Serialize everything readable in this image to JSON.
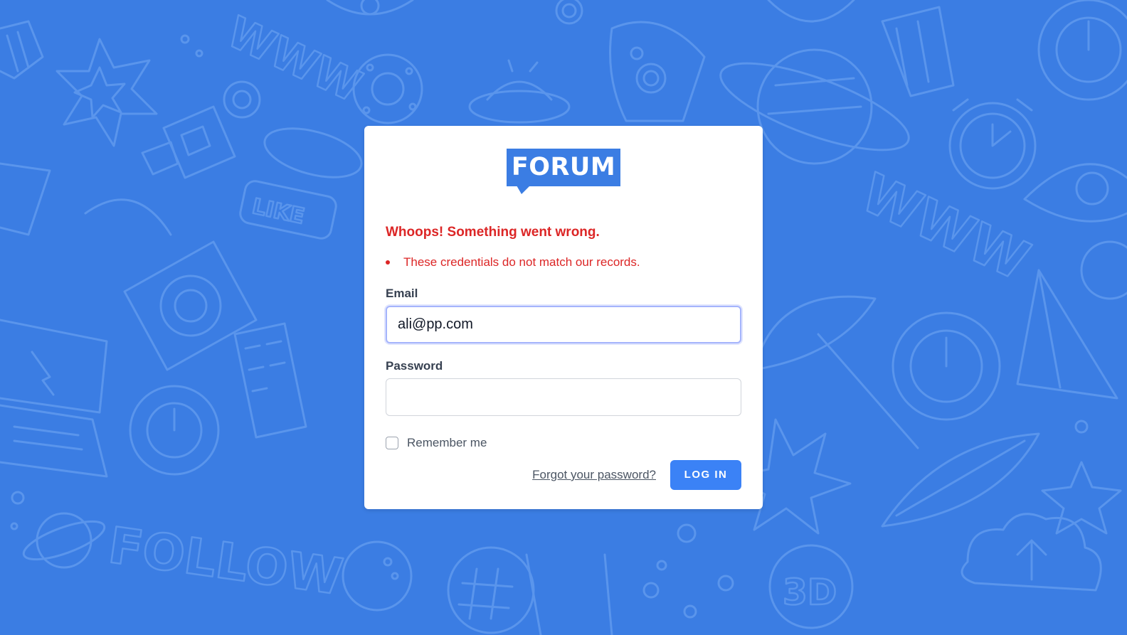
{
  "brand": {
    "logo_text": "FORUM"
  },
  "errors": {
    "title": "Whoops! Something went wrong.",
    "items": [
      "These credentials do not match our records."
    ]
  },
  "form": {
    "email_label": "Email",
    "email_value": "ali@pp.com",
    "password_label": "Password",
    "password_value": "",
    "remember_label": "Remember me",
    "remember_checked": false,
    "forgot_link": "Forgot your password?",
    "login_button": "LOG IN"
  },
  "background_doodles": {
    "like_text": "LIKE",
    "follow_text": "FOLLOW",
    "www_text": "WWW",
    "threed_text": "3D"
  },
  "colors": {
    "background": "#3b7de3",
    "doodle_stroke": "#5a95ec",
    "error": "#dc2626",
    "button": "#3b82f6",
    "focus_ring": "#a5b4fc"
  }
}
